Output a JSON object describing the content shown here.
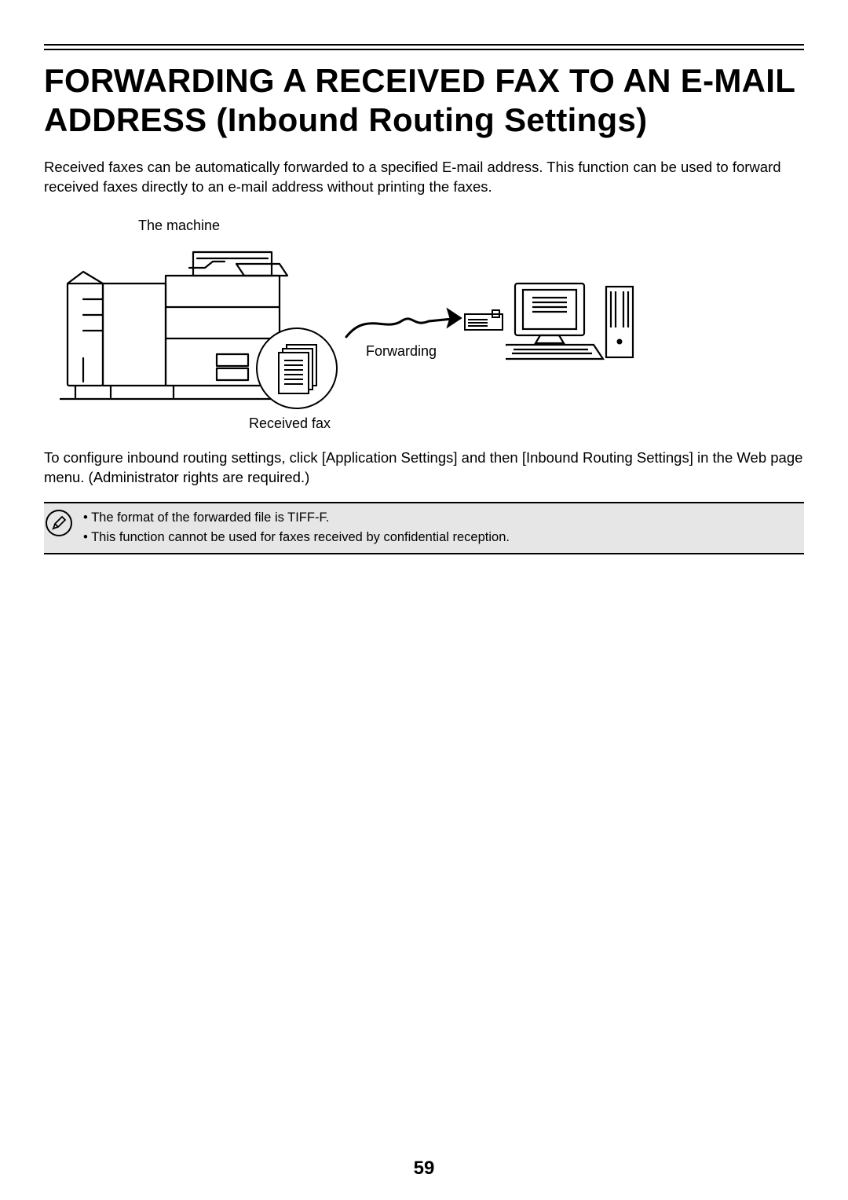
{
  "title": "FORWARDING A RECEIVED FAX TO AN E-MAIL ADDRESS (Inbound Routing Settings)",
  "intro": "Received faxes can be automatically forwarded to a specified E-mail address. This function can be used to forward received faxes directly to an e-mail address without printing the faxes.",
  "figure": {
    "machine_label": "The machine",
    "forwarding_label": "Forwarding",
    "received_fax_label": "Received fax"
  },
  "config_text": "To configure inbound routing settings, click [Application Settings] and then [Inbound Routing Settings] in the Web page menu. (Administrator rights are required.)",
  "notes": {
    "items": [
      "The format of the forwarded file is TIFF-F.",
      "This function cannot be used for faxes received by confidential reception."
    ]
  },
  "page_number": "59"
}
